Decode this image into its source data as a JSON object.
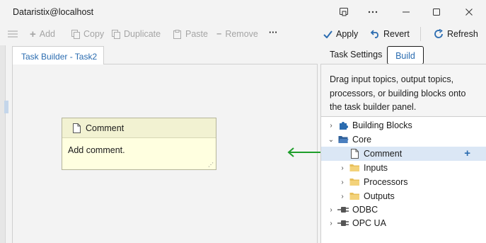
{
  "window": {
    "title": "Dataristix@localhost"
  },
  "toolbar": {
    "add": "Add",
    "copy": "Copy",
    "duplicate": "Duplicate",
    "paste": "Paste",
    "remove": "Remove",
    "more": "···",
    "apply": "Apply",
    "revert": "Revert",
    "refresh": "Refresh"
  },
  "editor": {
    "tab": "Task Builder - Task2"
  },
  "note": {
    "title": "Comment",
    "body": "Add comment."
  },
  "right": {
    "tab_settings": "Task Settings",
    "tab_build": "Build",
    "help": "Drag input topics, output topics, processors, or building blocks onto the task builder panel."
  },
  "tree": [
    {
      "label": "Building Blocks",
      "icon": "puzzle-icon",
      "chevron": "›"
    },
    {
      "label": "Core",
      "icon": "folder-open-icon",
      "chevron": "⌄"
    },
    {
      "label": "Comment",
      "icon": "document-icon",
      "chevron": ""
    },
    {
      "label": "Inputs",
      "icon": "folder-icon",
      "chevron": "›"
    },
    {
      "label": "Processors",
      "icon": "folder-icon",
      "chevron": "›"
    },
    {
      "label": "Outputs",
      "icon": "folder-icon",
      "chevron": "›"
    },
    {
      "label": "ODBC",
      "icon": "plug-icon",
      "chevron": "›"
    },
    {
      "label": "OPC UA",
      "icon": "plug-icon",
      "chevron": "›"
    }
  ],
  "colors": {
    "accent": "#2b6cb0",
    "arrow": "#1e9e2a",
    "folder": "#e7bf5a",
    "note": "#ffffe0"
  }
}
